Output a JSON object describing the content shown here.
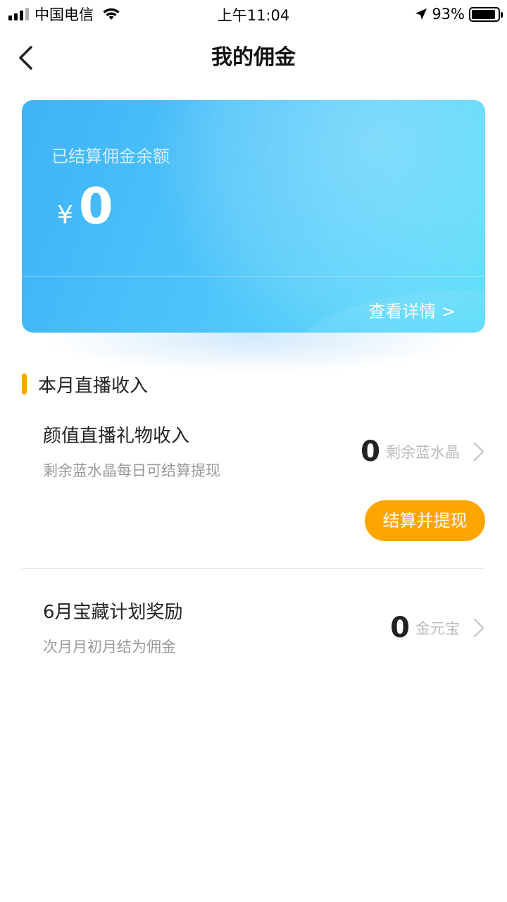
{
  "status_bar": {
    "carrier": "中国电信",
    "time": "上午11:04",
    "battery_percent": "93%",
    "icons": [
      "signal-icon",
      "wifi-icon",
      "location-arrow-icon",
      "battery-icon"
    ]
  },
  "navbar": {
    "title": "我的佣金",
    "back_icon": "chevron-left-icon"
  },
  "balance_card": {
    "label": "已结算佣金余额",
    "currency": "¥",
    "amount": "0",
    "detail_link": "查看详情 >",
    "colors": {
      "start": "#3fb3f6",
      "end": "#55dcfb"
    }
  },
  "section": {
    "title": "本月直播收入",
    "accent_color": "#ffa500"
  },
  "items": [
    {
      "title": "颜值直播礼物收入",
      "subtitle": "剩余蓝水晶每日可结算提现",
      "value": "0",
      "unit": "剩余蓝水晶",
      "action_label": "结算并提现"
    },
    {
      "title": "6月宝藏计划奖励",
      "subtitle": "次月月初月结为佣金",
      "value": "0",
      "unit": "金元宝"
    }
  ]
}
